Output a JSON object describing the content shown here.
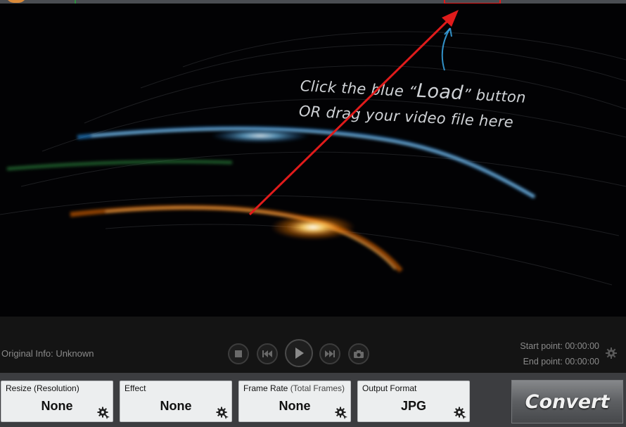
{
  "viewer": {
    "hint_line1_prefix": "Click the blue “",
    "hint_load_word": "Load",
    "hint_line1_suffix": "” button",
    "hint_line2": "OR drag your video file here"
  },
  "controls": {
    "original_info": "Original Info: Unknown",
    "start_point": "Start point: 00:00:00",
    "end_point": "End point: 00:00:00"
  },
  "settings": [
    {
      "label": "Resize (Resolution)",
      "label_sub": "",
      "value": "None"
    },
    {
      "label": "Effect",
      "label_sub": "",
      "value": "None"
    },
    {
      "label": "Frame Rate ",
      "label_sub": "(Total Frames)",
      "value": "None"
    },
    {
      "label": "Output Format",
      "label_sub": "",
      "value": "JPG"
    }
  ],
  "convert_label": "Convert",
  "icons": [
    "stop-icon",
    "previous-icon",
    "play-icon",
    "next-icon",
    "camera-icon",
    "gear-icon"
  ],
  "colors": {
    "annotation_red": "#e01b1b",
    "streak_blue": "#3aa8e8",
    "streak_orange": "#ff9a1a",
    "streak_green": "#2f8f3f",
    "panel_bg": "#3c3d40"
  }
}
